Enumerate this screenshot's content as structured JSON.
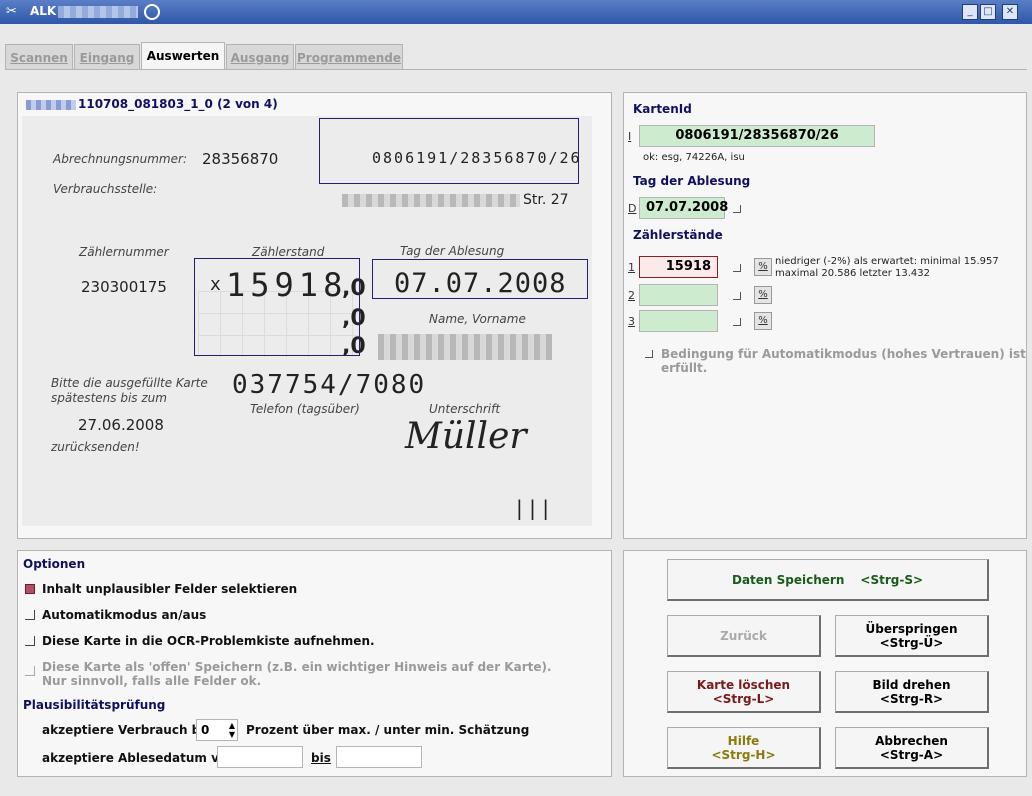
{
  "window": {
    "title": "ALK",
    "min": "_",
    "max": "□",
    "close": "✕"
  },
  "tabs": [
    {
      "label": "Scannen"
    },
    {
      "label": "Eingang"
    },
    {
      "label": "Auswerten"
    },
    {
      "label": "Ausgang"
    },
    {
      "label": "Programmende"
    }
  ],
  "scan": {
    "title": "110708_081803_1_0 (2 von 4)",
    "card": {
      "abrechnungsnummer_label": "Abrechnungsnummer:",
      "abrechnungsnummer": "28356870",
      "kartenid_handwritten": "0806191/28356870/26",
      "verbrauchsstelle_label": "Verbrauchsstelle:",
      "street_suffix": "Str. 27",
      "zaehlernummer_label": "Zählernummer",
      "zaehlernummer": "230300175",
      "zaehlerstand_label": "Zählerstand",
      "zaehlerstand_prefix": "x",
      "zaehlerstand": "15918",
      "comma_zero_1": ",0",
      "comma_zero_2": ",0",
      "comma_zero_3": ",0",
      "tag_label": "Tag der Ablesung",
      "tag_handwritten": "07.07.2008",
      "name_label": "Name, Vorname",
      "bitte_text_1": "Bitte die ausgefüllte Karte",
      "bitte_text_2": "spätestens bis zum",
      "deadline": "27.06.2008",
      "zuruecksenden": "zurücksenden!",
      "telefon_handwritten": "037754/7080",
      "telefon_label": "Telefon (tagsüber)",
      "unterschrift_label": "Unterschrift",
      "signature": "Müller",
      "marks": "| | |"
    }
  },
  "details": {
    "kartenid_heading": "KartenId",
    "kartenid_key": "I",
    "kartenid_value": "0806191/28356870/26",
    "kartenid_status": "ok: esg, 74226A, isu",
    "tag_heading": "Tag der Ablesung",
    "tag_key": "D",
    "tag_value": "07.07.2008",
    "zaehler_heading": "Zählerstände",
    "rows": [
      {
        "key": "1",
        "value": "15918",
        "pct": "%"
      },
      {
        "key": "2",
        "value": "",
        "pct": "%"
      },
      {
        "key": "3",
        "value": "",
        "pct": "%"
      }
    ],
    "hint_line_1": "niedriger (-2%) als erwartet: minimal 15.957",
    "hint_line_2": "maximal 20.586 letzter 13.432",
    "automatik_condition": "Bedingung für Automatikmodus (hohes Vertrauen) ist erfüllt."
  },
  "options": {
    "heading": "Optionen",
    "items": [
      {
        "label": "Inhalt unplausibler Felder selektieren"
      },
      {
        "label": "Automatikmodus an/aus"
      },
      {
        "label": "Diese Karte in die OCR-Problemkiste aufnehmen."
      },
      {
        "label_1": "Diese Karte als 'offen' Speichern (z.B. ein wichtiger Hinweis auf der Karte).",
        "label_2": "Nur sinnvoll, falls alle Felder ok."
      }
    ],
    "plaus_heading": "Plausibilitätsprüfung",
    "verbrauch_label": "akzeptiere Verbrauch bis",
    "verbrauch_value": "0",
    "verbrauch_suffix": "Prozent über max. / unter min. Schätzung",
    "datum_label": "akzeptiere Ablesedatum von",
    "datum_bis": "bis",
    "datum_from": "",
    "datum_to": ""
  },
  "actions": {
    "save": {
      "label": "Daten Speichern",
      "shortcut": "<Strg-S>"
    },
    "back": {
      "label": "Zurück"
    },
    "skip": {
      "label": "Überspringen",
      "shortcut": "<Strg-Ü>"
    },
    "delete": {
      "label": "Karte löschen",
      "shortcut": "<Strg-L>"
    },
    "rotate": {
      "label": "Bild drehen",
      "shortcut": "<Strg-R>"
    },
    "help": {
      "label": "Hilfe",
      "shortcut": "<Strg-H>"
    },
    "cancel": {
      "label": "Abbrechen",
      "shortcut": "<Strg-A>"
    }
  },
  "colors": {
    "save": "#1a5a1a",
    "delete": "#7a1a1a",
    "help": "#8a7a10",
    "heading": "#101060"
  }
}
